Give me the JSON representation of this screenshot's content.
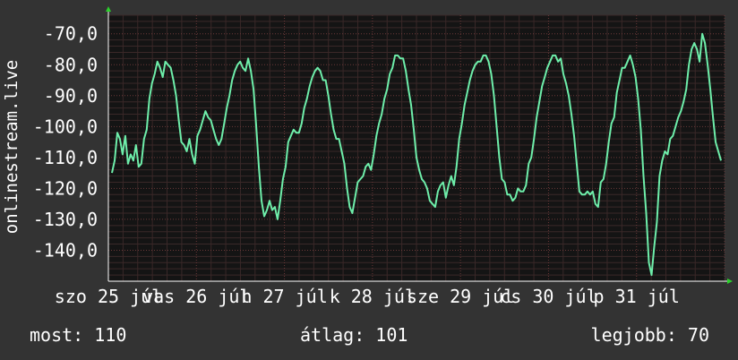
{
  "chart_data": {
    "type": "line",
    "ylabel": "onlinestream.live",
    "ylim": [
      -150,
      -64
    ],
    "y_ticks": [
      "-70,0",
      "-80,0",
      "-90,0",
      "-100,0",
      "-110,0",
      "-120,0",
      "-130,0",
      "-140,0"
    ],
    "x_tick_labels": [
      "szo 25 júl",
      "vas 26 júl",
      "h 27 júl",
      "k 28 júl",
      "sze 29 júl",
      "cs 30 júl",
      "p 31 júl"
    ],
    "x_range": [
      "2020-07-25",
      "2020-08-01"
    ],
    "grid": true,
    "series_color": "#6eeeaa",
    "series": [
      {
        "values": [
          -115,
          -111,
          -102,
          -104,
          -109,
          -103,
          -112,
          -109,
          -111,
          -106,
          -113,
          -112,
          -104,
          -101,
          -91,
          -86,
          -83,
          -79,
          -81,
          -84,
          -79,
          -80,
          -81,
          -85,
          -90,
          -98,
          -105,
          -106,
          -108,
          -104,
          -109,
          -112,
          -103,
          -101,
          -98,
          -95,
          -97,
          -98,
          -101,
          -104,
          -106,
          -104,
          -99,
          -94,
          -90,
          -85,
          -82,
          -80,
          -79,
          -81,
          -82,
          -78,
          -82,
          -88,
          -100,
          -113,
          -124,
          -129,
          -127,
          -124,
          -127,
          -126,
          -130,
          -124,
          -117,
          -113,
          -105,
          -103,
          -101,
          -102,
          -102,
          -99,
          -94,
          -91,
          -87,
          -84,
          -82,
          -81,
          -82,
          -85,
          -85,
          -90,
          -96,
          -101,
          -104,
          -104,
          -108,
          -112,
          -120,
          -126,
          -128,
          -123,
          -118,
          -117,
          -116,
          -113,
          -112,
          -114,
          -109,
          -103,
          -99,
          -96,
          -91,
          -88,
          -83,
          -81,
          -77,
          -77,
          -78,
          -78,
          -82,
          -88,
          -93,
          -101,
          -110,
          -114,
          -117,
          -118,
          -120,
          -124,
          -125,
          -126,
          -121,
          -119,
          -118,
          -123,
          -119,
          -116,
          -119,
          -113,
          -104,
          -99,
          -93,
          -89,
          -85,
          -82,
          -80,
          -79,
          -79,
          -77,
          -77,
          -79,
          -83,
          -90,
          -100,
          -110,
          -117,
          -118,
          -122,
          -122,
          -124,
          -123,
          -120,
          -121,
          -121,
          -119,
          -112,
          -110,
          -104,
          -97,
          -92,
          -87,
          -84,
          -81,
          -79,
          -77,
          -77,
          -79,
          -78,
          -83,
          -86,
          -90,
          -96,
          -103,
          -112,
          -121,
          -122,
          -122,
          -121,
          -122,
          -121,
          -125,
          -126,
          -118,
          -117,
          -112,
          -105,
          -99,
          -97,
          -89,
          -85,
          -81,
          -81,
          -79,
          -77,
          -80,
          -84,
          -91,
          -101,
          -116,
          -128,
          -144,
          -148,
          -139,
          -131,
          -116,
          -111,
          -108,
          -109,
          -104,
          -103,
          -100,
          -97,
          -95,
          -92,
          -88,
          -80,
          -75,
          -73,
          -75,
          -79,
          -70,
          -73,
          -80,
          -88,
          -97,
          -105,
          -108,
          -111
        ]
      }
    ]
  },
  "stats": {
    "now": "most: 110",
    "avg": "átlag: 101",
    "best": "legjobb: 70"
  }
}
